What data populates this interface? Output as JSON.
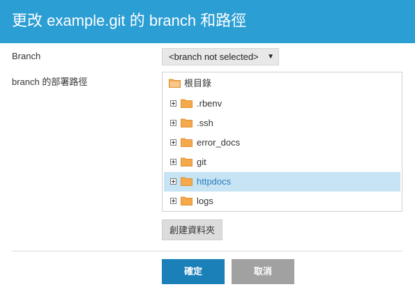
{
  "dialog": {
    "title": "更改 example.git 的 branch 和路徑"
  },
  "form": {
    "branch_label": "Branch",
    "branch_select_value": "<branch not selected>",
    "path_label": "branch 的部署路徑"
  },
  "tree": {
    "root": {
      "label": "根目錄",
      "icon": "folder-icon"
    },
    "items": [
      {
        "label": ".rbenv",
        "selected": false
      },
      {
        "label": ".ssh",
        "selected": false
      },
      {
        "label": "error_docs",
        "selected": false
      },
      {
        "label": "git",
        "selected": false
      },
      {
        "label": "httpdocs",
        "selected": true
      },
      {
        "label": "logs",
        "selected": false
      }
    ]
  },
  "buttons": {
    "new_folder": "創建資料夾",
    "ok": "確定",
    "cancel": "取消"
  },
  "colors": {
    "titlebar": "#2b9ed4",
    "primary_button": "#1b7fb8",
    "selected_row": "#c6e4f3",
    "folder": "#f5a94d"
  }
}
